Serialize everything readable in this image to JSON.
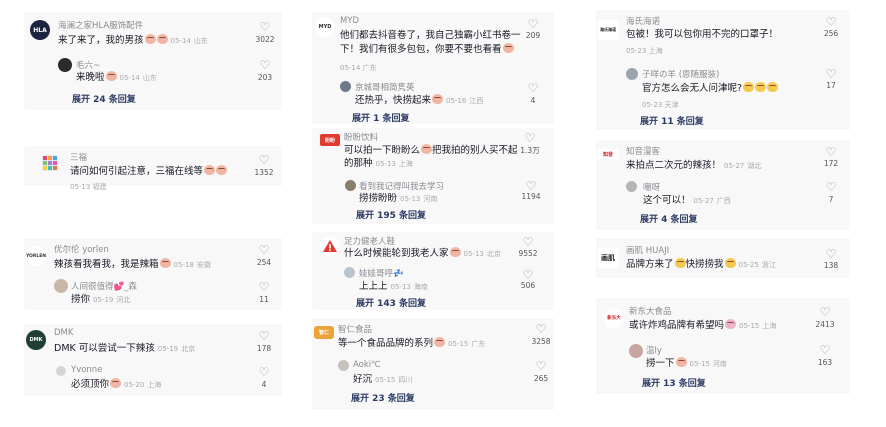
{
  "cards": [
    {
      "id": "c1",
      "main": {
        "name": "海澜之家HLA服饰配件",
        "text": "来了来了，我的男孩",
        "emojis": 2,
        "date": "05-14",
        "loc": "山东",
        "likes": "3022",
        "avatar_color": "#1c2440",
        "avatar_text": "HLA"
      },
      "sub": {
        "name": "毛六~",
        "text": "来晚啦",
        "emojis": 1,
        "date": "05-14",
        "loc": "山东",
        "likes": "203",
        "avatar_color": "#2b2b2b"
      },
      "expand": "展开 24 条回复"
    },
    {
      "id": "c2",
      "main": {
        "name": "三福",
        "text": "请问如何引起注意，三福在线等",
        "emojis": 2,
        "date": "05-13",
        "loc": "福建",
        "likes": "1352",
        "avatar_color": "#e8e4f2",
        "avatar_text": ""
      },
      "sub": null,
      "expand": ""
    },
    {
      "id": "c3",
      "main": {
        "name": "优尔伦 yorlen",
        "text": "辣孩看我看我，我是辣箱",
        "emojis": 1,
        "date": "05-18",
        "loc": "安徽",
        "likes": "254",
        "avatar_color": "#ffffff",
        "avatar_text": "YORLEN"
      },
      "sub": {
        "name": "人间很值得💕_森",
        "text": "捞你",
        "emojis": 0,
        "date": "05-19",
        "loc": "河北",
        "likes": "11",
        "avatar_color": "#c9b7a7"
      },
      "expand": ""
    },
    {
      "id": "c4",
      "main": {
        "name": "DMK",
        "text": "DMK 可以尝试一下辣孩",
        "emojis": 0,
        "date": "05-19",
        "loc": "北京",
        "likes": "178",
        "avatar_color": "#1f3f35",
        "avatar_text": "DMK"
      },
      "sub": {
        "name": "Yvonne",
        "text": "必须顶你",
        "emojis": 1,
        "date": "05-20",
        "loc": "上海",
        "likes": "4",
        "avatar_color": "#d5d5d5"
      },
      "expand": ""
    },
    {
      "id": "c5",
      "main": {
        "name": "MYD",
        "text": "他们都去抖音卷了，我自己独霸小红书卷一",
        "text2": "下！我们有很多包包，你要不要也看看",
        "emojis": 1,
        "date": "05-14",
        "loc": "广东",
        "likes": "209",
        "avatar_color": "#ffffff",
        "avatar_text": "MYD"
      },
      "sub": {
        "name": "京城哥相简隽英",
        "text": "还热乎，快捞起来",
        "emojis": 1,
        "date": "05-16",
        "loc": "江西",
        "likes": "4",
        "avatar_color": "#6b7a8a"
      },
      "expand": "展开 1 条回复"
    },
    {
      "id": "c6",
      "main": {
        "name": "盼盼饮料",
        "text": "可以拍一下盼盼么",
        "text2": "把我拍的别人买不起",
        "text3": "的那种",
        "emojis": 1,
        "date": "05-13",
        "loc": "上海",
        "likes": "1.3万",
        "avatar_color": "#e33a2f",
        "avatar_text": "盼盼"
      },
      "sub": {
        "name": "看到我记得叫我去学习",
        "text": "捞捞盼盼",
        "emojis": 0,
        "date": "05-13",
        "loc": "河南",
        "likes": "1194",
        "avatar_color": "#8a7d6b"
      },
      "expand": "展开 195 条回复"
    },
    {
      "id": "c7",
      "main": {
        "name": "足力健老人鞋",
        "text": "什么时候能轮到我老人家",
        "emojis": 1,
        "date": "05-13",
        "loc": "北京",
        "likes": "9552",
        "avatar_color": "#ffffff",
        "avatar_text": "足力健"
      },
      "sub": {
        "name": "娃娃哥呼💤",
        "text": "上上上",
        "emojis": 0,
        "date": "05-13",
        "loc": "海南",
        "likes": "506",
        "avatar_color": "#b9c4cf"
      },
      "expand": "展开 143 条回复"
    },
    {
      "id": "c8",
      "main": {
        "name": "智仁食品",
        "text": "等一个食品品牌的系列",
        "emojis": 1,
        "date": "05-15",
        "loc": "广东",
        "likes": "3258",
        "avatar_color": "#e9a33a",
        "avatar_text": "智仁"
      },
      "sub": {
        "name": "Aoki℃",
        "text": "好沉",
        "emojis": 0,
        "date": "05-15",
        "loc": "四川",
        "likes": "265",
        "avatar_color": "#c7c2bc"
      },
      "expand": "展开 23 条回复"
    },
    {
      "id": "c9",
      "main": {
        "name": "海氏海诺",
        "text": "包被！我可以包你用不完的口罩子！",
        "emojis": 0,
        "date": "05-23",
        "loc": "上海",
        "likes": "256",
        "avatar_color": "#ffffff",
        "avatar_text": "海氏海诺"
      },
      "sub": {
        "name": "子咩の羊 (恩随服装)",
        "text": "官方怎么会无人问津呢?",
        "emojis": 3,
        "date": "05-23",
        "loc": "天津",
        "likes": "17",
        "avatar_color": "#9aa4ad"
      },
      "expand": "展开 11 条回复"
    },
    {
      "id": "c10",
      "main": {
        "name": "知音漫客",
        "text": "来拍点二次元的辣孩！",
        "emojis": 0,
        "date": "05-27",
        "loc": "湖北",
        "likes": "172",
        "avatar_color": "#ffffff",
        "avatar_text": "知音"
      },
      "sub": {
        "name": "嘲呀",
        "text": "这个可以！",
        "emojis": 0,
        "date": "05-27",
        "loc": "广西",
        "likes": "7",
        "avatar_color": "#b5b5b5"
      },
      "expand": "展开 4 条回复"
    },
    {
      "id": "c11",
      "main": {
        "name": "画肌 HUAJI",
        "text": "品牌方来了",
        "text2": "快捞捞我",
        "emojis": 2,
        "date": "05-25",
        "loc": "浙江",
        "likes": "138",
        "avatar_color": "#ffffff",
        "avatar_text": "画肌"
      },
      "sub": null,
      "expand": ""
    },
    {
      "id": "c12",
      "main": {
        "name": "新东大食品",
        "text": "或许炸鸡品牌有希望吗",
        "emojis": 1,
        "date": "05-15",
        "loc": "上海",
        "likes": "2413",
        "avatar_color": "#ffffff",
        "avatar_text": "新东大"
      },
      "sub": {
        "name": "温ly",
        "text": "捞一下",
        "emojis": 1,
        "date": "05-15",
        "loc": "河南",
        "likes": "163",
        "avatar_color": "#c8a5a0"
      },
      "expand": "展开 13 条回复"
    }
  ]
}
